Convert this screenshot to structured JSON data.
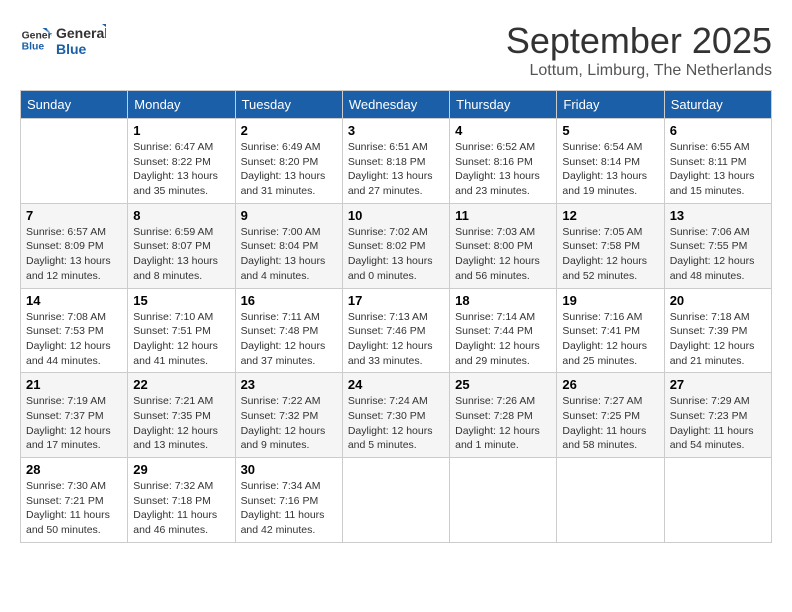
{
  "logo": {
    "line1": "General",
    "line2": "Blue"
  },
  "title": "September 2025",
  "subtitle": "Lottum, Limburg, The Netherlands",
  "days_of_week": [
    "Sunday",
    "Monday",
    "Tuesday",
    "Wednesday",
    "Thursday",
    "Friday",
    "Saturday"
  ],
  "weeks": [
    [
      {
        "day": "",
        "info": ""
      },
      {
        "day": "1",
        "info": "Sunrise: 6:47 AM\nSunset: 8:22 PM\nDaylight: 13 hours\nand 35 minutes."
      },
      {
        "day": "2",
        "info": "Sunrise: 6:49 AM\nSunset: 8:20 PM\nDaylight: 13 hours\nand 31 minutes."
      },
      {
        "day": "3",
        "info": "Sunrise: 6:51 AM\nSunset: 8:18 PM\nDaylight: 13 hours\nand 27 minutes."
      },
      {
        "day": "4",
        "info": "Sunrise: 6:52 AM\nSunset: 8:16 PM\nDaylight: 13 hours\nand 23 minutes."
      },
      {
        "day": "5",
        "info": "Sunrise: 6:54 AM\nSunset: 8:14 PM\nDaylight: 13 hours\nand 19 minutes."
      },
      {
        "day": "6",
        "info": "Sunrise: 6:55 AM\nSunset: 8:11 PM\nDaylight: 13 hours\nand 15 minutes."
      }
    ],
    [
      {
        "day": "7",
        "info": "Sunrise: 6:57 AM\nSunset: 8:09 PM\nDaylight: 13 hours\nand 12 minutes."
      },
      {
        "day": "8",
        "info": "Sunrise: 6:59 AM\nSunset: 8:07 PM\nDaylight: 13 hours\nand 8 minutes."
      },
      {
        "day": "9",
        "info": "Sunrise: 7:00 AM\nSunset: 8:04 PM\nDaylight: 13 hours\nand 4 minutes."
      },
      {
        "day": "10",
        "info": "Sunrise: 7:02 AM\nSunset: 8:02 PM\nDaylight: 13 hours\nand 0 minutes."
      },
      {
        "day": "11",
        "info": "Sunrise: 7:03 AM\nSunset: 8:00 PM\nDaylight: 12 hours\nand 56 minutes."
      },
      {
        "day": "12",
        "info": "Sunrise: 7:05 AM\nSunset: 7:58 PM\nDaylight: 12 hours\nand 52 minutes."
      },
      {
        "day": "13",
        "info": "Sunrise: 7:06 AM\nSunset: 7:55 PM\nDaylight: 12 hours\nand 48 minutes."
      }
    ],
    [
      {
        "day": "14",
        "info": "Sunrise: 7:08 AM\nSunset: 7:53 PM\nDaylight: 12 hours\nand 44 minutes."
      },
      {
        "day": "15",
        "info": "Sunrise: 7:10 AM\nSunset: 7:51 PM\nDaylight: 12 hours\nand 41 minutes."
      },
      {
        "day": "16",
        "info": "Sunrise: 7:11 AM\nSunset: 7:48 PM\nDaylight: 12 hours\nand 37 minutes."
      },
      {
        "day": "17",
        "info": "Sunrise: 7:13 AM\nSunset: 7:46 PM\nDaylight: 12 hours\nand 33 minutes."
      },
      {
        "day": "18",
        "info": "Sunrise: 7:14 AM\nSunset: 7:44 PM\nDaylight: 12 hours\nand 29 minutes."
      },
      {
        "day": "19",
        "info": "Sunrise: 7:16 AM\nSunset: 7:41 PM\nDaylight: 12 hours\nand 25 minutes."
      },
      {
        "day": "20",
        "info": "Sunrise: 7:18 AM\nSunset: 7:39 PM\nDaylight: 12 hours\nand 21 minutes."
      }
    ],
    [
      {
        "day": "21",
        "info": "Sunrise: 7:19 AM\nSunset: 7:37 PM\nDaylight: 12 hours\nand 17 minutes."
      },
      {
        "day": "22",
        "info": "Sunrise: 7:21 AM\nSunset: 7:35 PM\nDaylight: 12 hours\nand 13 minutes."
      },
      {
        "day": "23",
        "info": "Sunrise: 7:22 AM\nSunset: 7:32 PM\nDaylight: 12 hours\nand 9 minutes."
      },
      {
        "day": "24",
        "info": "Sunrise: 7:24 AM\nSunset: 7:30 PM\nDaylight: 12 hours\nand 5 minutes."
      },
      {
        "day": "25",
        "info": "Sunrise: 7:26 AM\nSunset: 7:28 PM\nDaylight: 12 hours\nand 1 minute."
      },
      {
        "day": "26",
        "info": "Sunrise: 7:27 AM\nSunset: 7:25 PM\nDaylight: 11 hours\nand 58 minutes."
      },
      {
        "day": "27",
        "info": "Sunrise: 7:29 AM\nSunset: 7:23 PM\nDaylight: 11 hours\nand 54 minutes."
      }
    ],
    [
      {
        "day": "28",
        "info": "Sunrise: 7:30 AM\nSunset: 7:21 PM\nDaylight: 11 hours\nand 50 minutes."
      },
      {
        "day": "29",
        "info": "Sunrise: 7:32 AM\nSunset: 7:18 PM\nDaylight: 11 hours\nand 46 minutes."
      },
      {
        "day": "30",
        "info": "Sunrise: 7:34 AM\nSunset: 7:16 PM\nDaylight: 11 hours\nand 42 minutes."
      },
      {
        "day": "",
        "info": ""
      },
      {
        "day": "",
        "info": ""
      },
      {
        "day": "",
        "info": ""
      },
      {
        "day": "",
        "info": ""
      }
    ]
  ]
}
